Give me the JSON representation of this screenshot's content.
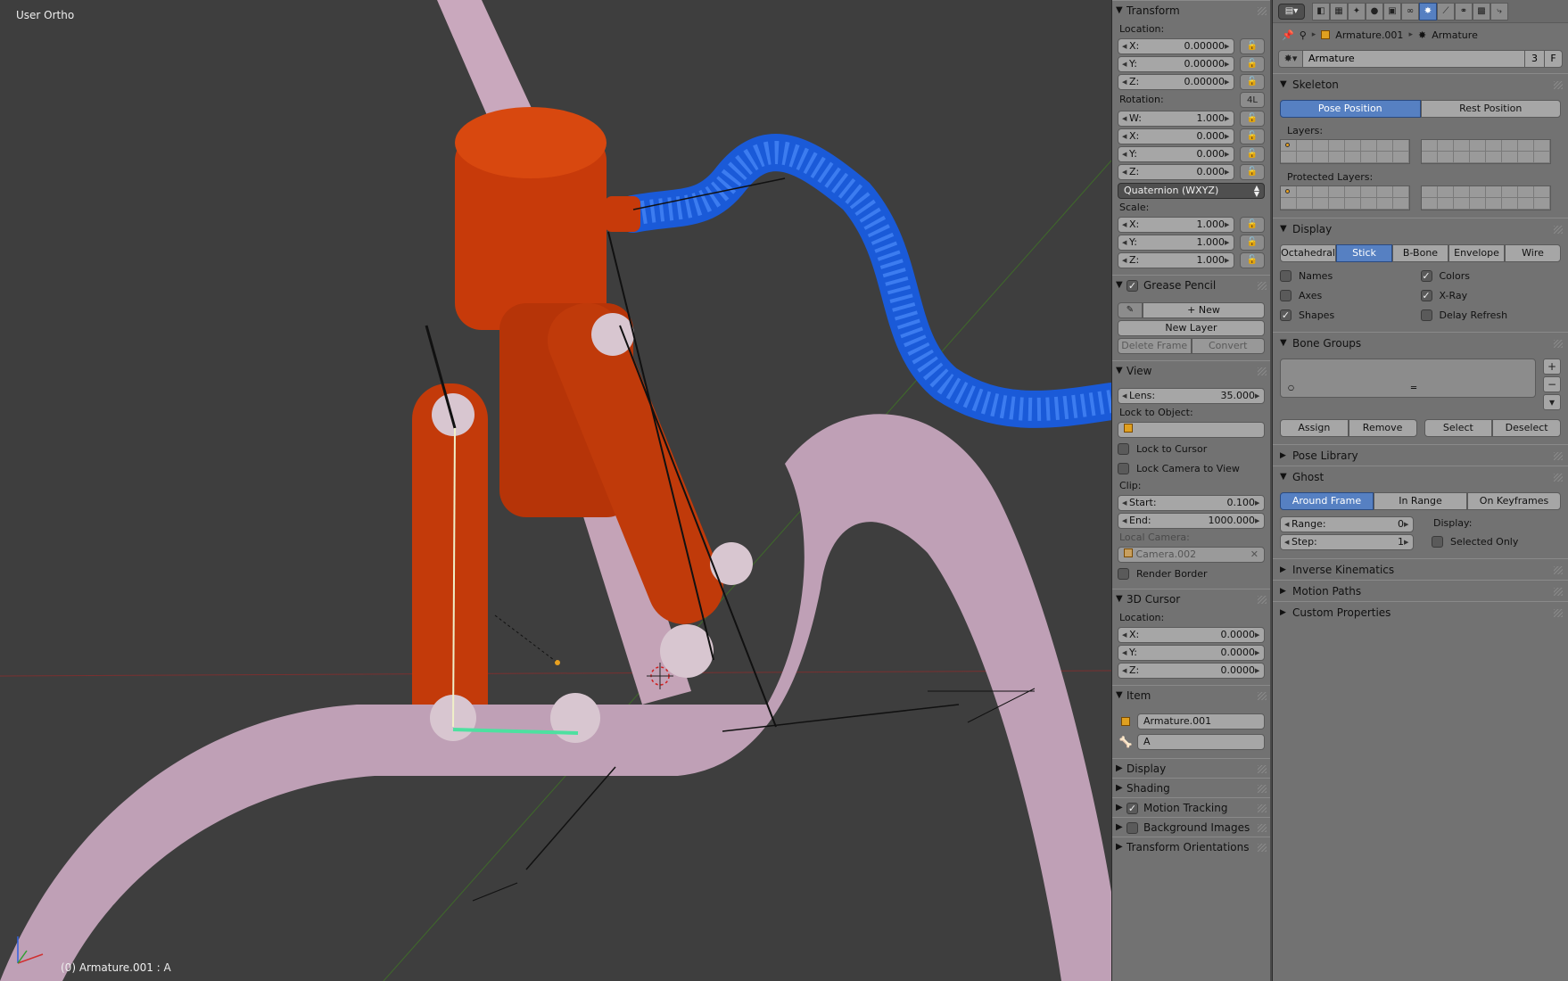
{
  "viewport": {
    "view_name": "User Ortho",
    "object_info": "(0) Armature.001 : A"
  },
  "npanel": {
    "transform": {
      "title": "Transform",
      "location_label": "Location:",
      "location": [
        {
          "axis": "X:",
          "value": "0.00000"
        },
        {
          "axis": "Y:",
          "value": "0.00000"
        },
        {
          "axis": "Z:",
          "value": "0.00000"
        }
      ],
      "rotation_label": "Rotation:",
      "rotation_4l": "4L",
      "rotation": [
        {
          "axis": "W:",
          "value": "1.000"
        },
        {
          "axis": "X:",
          "value": "0.000"
        },
        {
          "axis": "Y:",
          "value": "0.000"
        },
        {
          "axis": "Z:",
          "value": "0.000"
        }
      ],
      "rotation_mode": "Quaternion (WXYZ)",
      "scale_label": "Scale:",
      "scale": [
        {
          "axis": "X:",
          "value": "1.000"
        },
        {
          "axis": "Y:",
          "value": "1.000"
        },
        {
          "axis": "Z:",
          "value": "1.000"
        }
      ]
    },
    "grease_pencil": {
      "title": "Grease Pencil",
      "new": "New",
      "new_layer": "New Layer",
      "delete_frame": "Delete Frame",
      "convert": "Convert"
    },
    "view": {
      "title": "View",
      "lens_label": "Lens:",
      "lens_value": "35.000",
      "lock_to_object": "Lock to Object:",
      "lock_to_cursor": "Lock to Cursor",
      "lock_camera": "Lock Camera to View",
      "clip_label": "Clip:",
      "clip_start_label": "Start:",
      "clip_start": "0.100",
      "clip_end_label": "End:",
      "clip_end": "1000.000",
      "local_camera": "Local Camera:",
      "camera_name": "Camera.002",
      "render_border": "Render Border"
    },
    "cursor": {
      "title": "3D Cursor",
      "location_label": "Location:",
      "location": [
        {
          "axis": "X:",
          "value": "0.0000"
        },
        {
          "axis": "Y:",
          "value": "0.0000"
        },
        {
          "axis": "Z:",
          "value": "0.0000"
        }
      ]
    },
    "item": {
      "title": "Item",
      "object_name": "Armature.001",
      "bone_name": "A"
    },
    "collapsed": [
      {
        "title": "Display",
        "check": false,
        "has_check": false
      },
      {
        "title": "Shading",
        "check": false,
        "has_check": false
      },
      {
        "title": "Motion Tracking",
        "check": true,
        "has_check": true
      },
      {
        "title": "Background Images",
        "check": false,
        "has_check": true
      },
      {
        "title": "Transform Orientations",
        "check": false,
        "has_check": false
      }
    ]
  },
  "props": {
    "breadcrumb": {
      "object": "Armature.001",
      "data": "Armature"
    },
    "datablock": {
      "name": "Armature",
      "users": "3",
      "fake": "F"
    },
    "skeleton": {
      "title": "Skeleton",
      "pose_position": "Pose Position",
      "rest_position": "Rest Position",
      "layers_label": "Layers:",
      "protected_label": "Protected Layers:"
    },
    "display": {
      "title": "Display",
      "modes": [
        "Octahedral",
        "Stick",
        "B-Bone",
        "Envelope",
        "Wire"
      ],
      "active_mode": "Stick",
      "names": "Names",
      "axes": "Axes",
      "shapes": "Shapes",
      "colors": "Colors",
      "xray": "X-Ray",
      "delay_refresh": "Delay Refresh"
    },
    "bone_groups": {
      "title": "Bone Groups",
      "assign": "Assign",
      "remove": "Remove",
      "select": "Select",
      "deselect": "Deselect"
    },
    "pose_library": {
      "title": "Pose Library"
    },
    "ghost": {
      "title": "Ghost",
      "around_frame": "Around Frame",
      "in_range": "In Range",
      "on_keyframes": "On Keyframes",
      "range_label": "Range:",
      "range_value": "0",
      "step_label": "Step:",
      "step_value": "1",
      "display_label": "Display:",
      "selected_only": "Selected Only"
    },
    "collapsed": [
      "Inverse Kinematics",
      "Motion Paths",
      "Custom Properties"
    ]
  }
}
